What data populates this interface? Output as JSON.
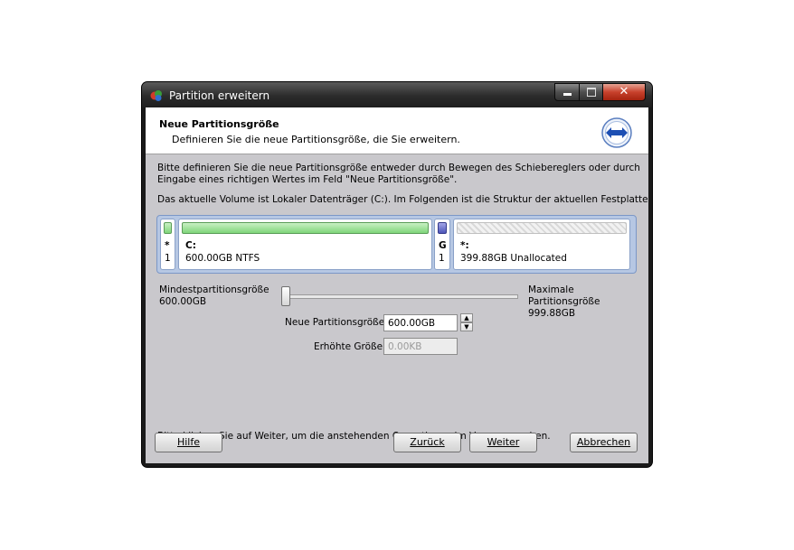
{
  "window": {
    "title": "Partition erweitern"
  },
  "header": {
    "title": "Neue Partitionsgröße",
    "subtitle": "Definieren Sie die neue Partitionsgröße, die Sie erweitern."
  },
  "description": {
    "line1": "Bitte definieren Sie die neue Partitionsgröße entweder durch Bewegen des Schiebereglers oder durch",
    "line2": "Eingabe eines richtigen Wertes im Feld \"Neue Partitionsgröße\".",
    "line3": "Das aktuelle Volume ist Lokaler Datenträger (C:). Im Folgenden ist die Struktur der aktuellen Festplatte."
  },
  "disk_map": {
    "partitions": [
      {
        "name": "*",
        "detail": "1",
        "color": "#7fd57a"
      },
      {
        "name": "C:",
        "detail": "600.00GB NTFS",
        "color": "#7fd57a"
      },
      {
        "name": "G",
        "detail": "1",
        "color": "#4d55b8"
      },
      {
        "name": "*:",
        "detail": "399.88GB Unallocated",
        "color": "#d9d9d9"
      }
    ]
  },
  "slider": {
    "min_label": "Mindestpartitionsgröße",
    "min_value": "600.00GB",
    "max_label_line1": "Maximale",
    "max_label_line2": "Partitionsgröße",
    "max_value": "999.88GB",
    "position": 0
  },
  "fields": {
    "new_size_label": "Neue Partitionsgröße",
    "new_size_value": "600.00GB",
    "increase_label": "Erhöhte Größe",
    "increase_value": "0.00KB"
  },
  "hint": "Bitte klicken Sie auf Weiter, um die anstehenden Operationen im Voraus zu sehen.",
  "buttons": {
    "help": "Hilfe",
    "back": "Zurück",
    "next": "Weiter",
    "cancel": "Abbrechen"
  }
}
